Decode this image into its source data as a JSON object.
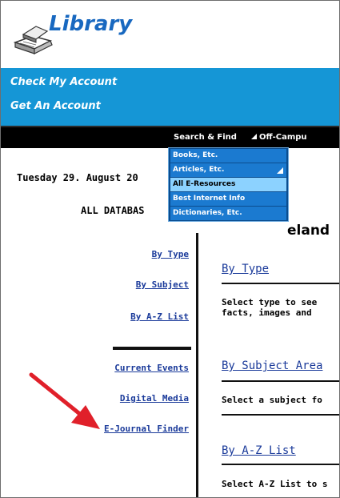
{
  "header": {
    "logo_text": "Library"
  },
  "account": {
    "links": [
      "Check My Account",
      "Get An Account"
    ]
  },
  "nav": {
    "search_find": "Search & Find",
    "off_campus": "Off-Campu"
  },
  "dropdown": {
    "items": [
      "Books, Etc.",
      "Articles, Etc.",
      "All E-Resources",
      "Best Internet Info",
      "Dictionaries, Etc."
    ],
    "active_item": "All E-Resources"
  },
  "sidebar": {
    "date": "Tuesday 29. August 20",
    "all_databases": "ALL DATABAS",
    "links_top": [
      "By Type",
      "By Subject",
      "By A-Z List"
    ],
    "links_bottom": [
      "Current Events",
      "Digital Media",
      "E-Journal Finder"
    ]
  },
  "main": {
    "heading": "eland",
    "sections": [
      {
        "title": "By Type",
        "text": "Select type to see\nfacts, images and"
      },
      {
        "title": "By Subject Area",
        "text": "Select a subject fo"
      },
      {
        "title": "By A-Z List",
        "text": "Select A-Z List to s"
      }
    ]
  },
  "colors": {
    "account_bar": "#1596d6",
    "nav_bar": "#000000",
    "menu_bg": "#1b7ad0",
    "menu_active": "#8cd2ff",
    "link": "#1a3a9a",
    "arrow": "#e0202a"
  }
}
